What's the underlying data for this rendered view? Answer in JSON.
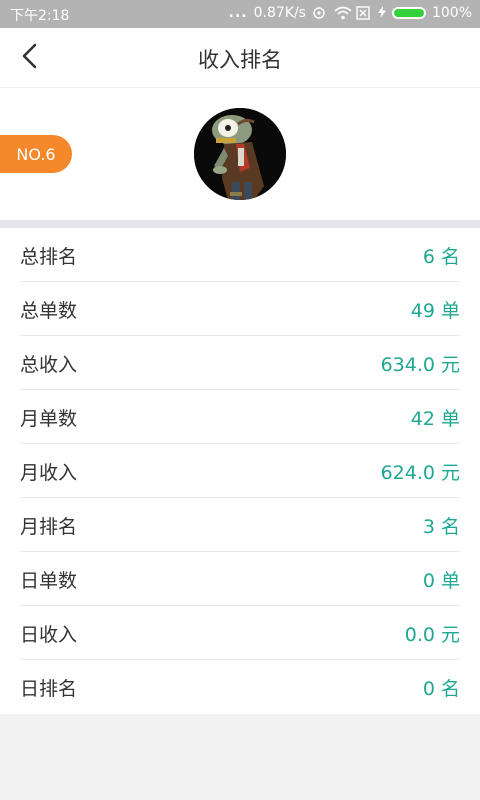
{
  "status_bar": {
    "time": "下午2:18",
    "dots": "...",
    "speed": "0.87K/s",
    "battery": "100%",
    "battery_color": "#34d13d"
  },
  "header": {
    "title": "收入排名",
    "back_icon": "chevron-left-icon"
  },
  "profile": {
    "rank_badge": "NO.6",
    "badge_color": "#f5882a",
    "avatar_icon": "zombie-avatar"
  },
  "stats": [
    {
      "label": "总排名",
      "value": "6 名"
    },
    {
      "label": "总单数",
      "value": "49 单"
    },
    {
      "label": "总收入",
      "value": "634.0 元"
    },
    {
      "label": "月单数",
      "value": "42 单"
    },
    {
      "label": "月收入",
      "value": "624.0 元"
    },
    {
      "label": "月排名",
      "value": "3 名"
    },
    {
      "label": "日单数",
      "value": "0 单"
    },
    {
      "label": "日收入",
      "value": "0.0 元"
    },
    {
      "label": "日排名",
      "value": "0 名"
    }
  ],
  "value_color": "#1fa891"
}
